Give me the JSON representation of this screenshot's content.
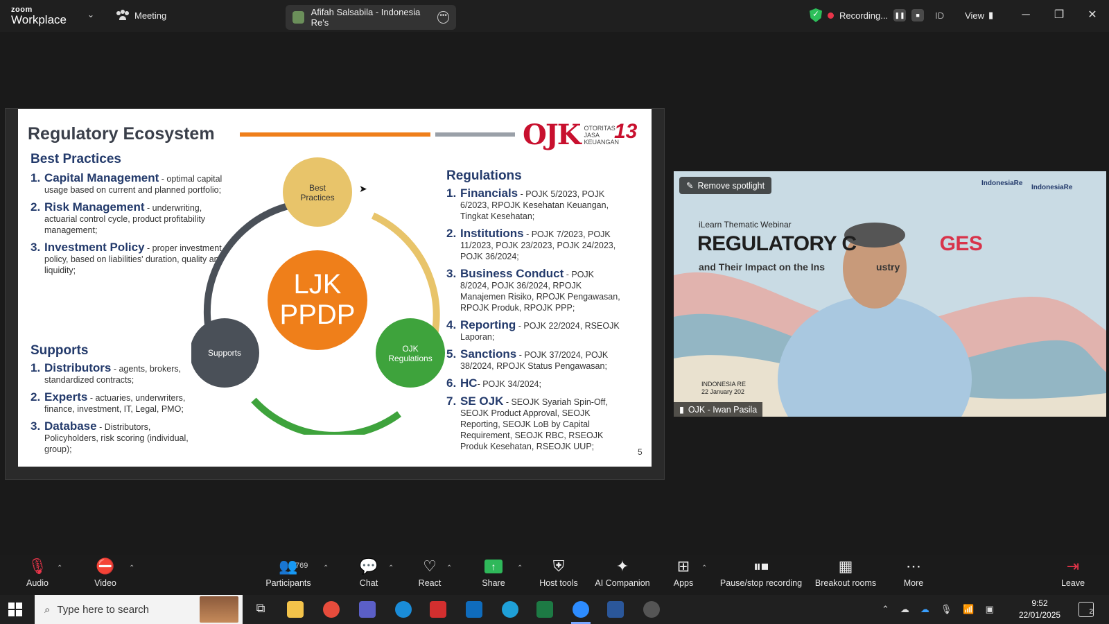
{
  "titlebar": {
    "brand_small": "zoom",
    "brand_big": "Workplace",
    "meeting_label": "Meeting",
    "window_title": "Afifah Salsabila - Indonesia Re's",
    "recording_label": "Recording...",
    "lang_label": "ID",
    "view_label": "View"
  },
  "slide": {
    "title": "Regulatory Ecosystem",
    "logo_text": "OTORITAS JASA KEUANGAN",
    "logo_mark": "OJK",
    "anniv": "13",
    "page_number": "5",
    "best_practices": {
      "heading": "Best Practices",
      "items": [
        {
          "num": "1.",
          "keyword": "Capital Management",
          "desc": " - optimal capital usage based on current and planned portfolio;"
        },
        {
          "num": "2.",
          "keyword": "Risk Management",
          "desc": " - underwriting, actuarial control cycle, product profitability management;"
        },
        {
          "num": "3.",
          "keyword": "Investment Policy",
          "desc": " - proper investment policy, based on liabilities' duration, quality and liquidity;"
        }
      ]
    },
    "supports": {
      "heading": "Supports",
      "items": [
        {
          "num": "1.",
          "keyword": "Distributors",
          "desc": " - agents, brokers, standardized contracts;"
        },
        {
          "num": "2.",
          "keyword": "Experts",
          "desc": " - actuaries, underwriters, finance, investment, IT, Legal, PMO;"
        },
        {
          "num": "3.",
          "keyword": "Database",
          "desc": " - Distributors, Policyholders, risk scoring (individual, group);"
        }
      ]
    },
    "regulations": {
      "heading": "Regulations",
      "items": [
        {
          "num": "1.",
          "keyword": "Financials",
          "desc": " - POJK 5/2023, POJK 6/2023, RPOJK Kesehatan Keuangan, Tingkat Kesehatan;"
        },
        {
          "num": "2.",
          "keyword": "Institutions",
          "desc": " - POJK 7/2023, POJK 11/2023, POJK 23/2023, POJK 24/2023, POJK 36/2024;"
        },
        {
          "num": "3.",
          "keyword": "Business Conduct",
          "desc": " - POJK 8/2024, POJK 36/2024, RPOJK Manajemen Risiko, RPOJK Pengawasan, RPOJK Produk, RPOJK PPP;"
        },
        {
          "num": "4.",
          "keyword": "Reporting",
          "desc": " - POJK 22/2024, RSEOJK Laporan;"
        },
        {
          "num": "5.",
          "keyword": "Sanctions",
          "desc": " - POJK 37/2024, POJK 38/2024, RPOJK Status Pengawasan;"
        },
        {
          "num": "6.",
          "keyword": "HC",
          "desc": "- POJK 34/2024;"
        },
        {
          "num": "7.",
          "keyword": "SE OJK",
          "desc": " - SEOJK Syariah Spin-Off, SEOJK Product Approval, SEOJK Reporting, SEOJK LoB by Capital Requirement, SEOJK RBC, RSEOJK Produk Kesehatan, RSEOJK UUP;"
        }
      ]
    },
    "diagram": {
      "center_line1": "LJK",
      "center_line2": "PPDP",
      "node_best_line1": "Best",
      "node_best_line2": "Practices",
      "node_supports": "Supports",
      "node_ojk_line1": "OJK",
      "node_ojk_line2": "Regulations",
      "colors": {
        "orange": "#ef7f1a",
        "yellow": "#e8c46a",
        "green": "#3ea33c",
        "dark": "#4a5058"
      }
    }
  },
  "video": {
    "spotlight_button": "Remove spotlight",
    "participant_name": "OJK - Iwan Pasila",
    "webinar_small": "iLearn Thematic Webinar",
    "webinar_title": "REGULATORY C",
    "webinar_title_end": "GES",
    "webinar_sub": "and Their Impact on the Ins",
    "webinar_sub_end": "ustry",
    "logo1": "IndonesiaRe",
    "logo2": "IndonesiaRe",
    "date_line1": "INDONESIA RE",
    "date_line2": "22 January 202"
  },
  "toolbar": {
    "audio": "Audio",
    "video": "Video",
    "participants": "Participants",
    "participants_count": "769",
    "chat": "Chat",
    "react": "React",
    "share": "Share",
    "host_tools": "Host tools",
    "ai_companion": "AI Companion",
    "apps": "Apps",
    "pause_stop": "Pause/stop recording",
    "breakout": "Breakout rooms",
    "more": "More",
    "leave": "Leave"
  },
  "taskbar": {
    "search_placeholder": "Type here to search",
    "time": "9:52",
    "date": "22/01/2025",
    "notif_count": "2"
  }
}
